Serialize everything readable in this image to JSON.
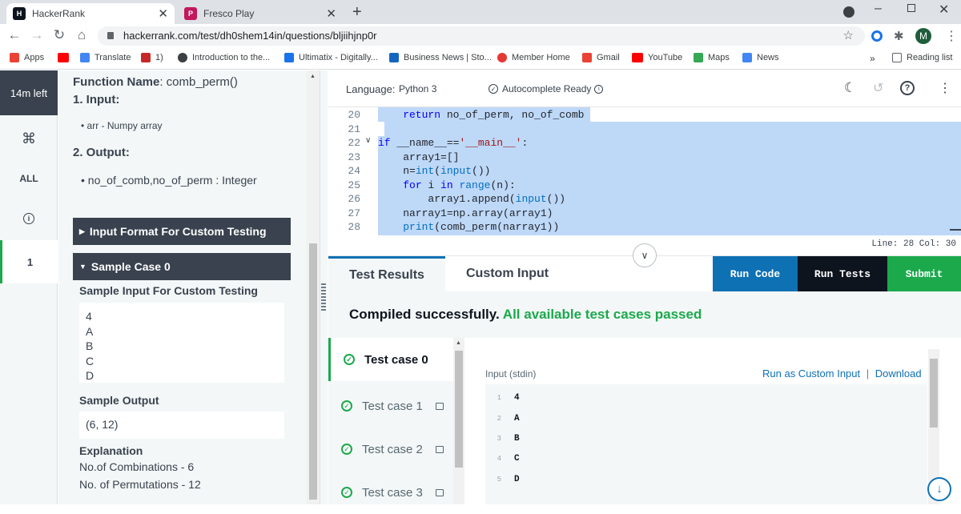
{
  "browser": {
    "tabs": [
      {
        "title": "HackerRank",
        "icon": "hackerrank-logo",
        "active": true
      },
      {
        "title": "Fresco Play",
        "icon": "fresco-logo",
        "active": false
      }
    ],
    "new_tab": "+",
    "url": "hackerrank.com/test/dh0shem14in/questions/bljiihjnp0r",
    "profile_initial": "M",
    "bookmarks": [
      {
        "label": "Apps",
        "color": "#ea4335"
      },
      {
        "label": "",
        "color": "#ff0000"
      },
      {
        "label": "Translate",
        "color": "#4285f4"
      },
      {
        "label": "1)",
        "color": "#c62828"
      },
      {
        "label": "Introduction to the...",
        "color": "#3c4043"
      },
      {
        "label": "Ultimatix - Digitally...",
        "color": "#1a73e8"
      },
      {
        "label": "Business News | Sto...",
        "color": "#1565c0"
      },
      {
        "label": "Member Home",
        "color": "#e53935"
      },
      {
        "label": "Gmail",
        "color": "#ea4335"
      },
      {
        "label": "YouTube",
        "color": "#ff0000"
      },
      {
        "label": "Maps",
        "color": "#34a853"
      },
      {
        "label": "News",
        "color": "#4285f4"
      }
    ],
    "more_bookmarks": "»",
    "reading_list": "Reading list"
  },
  "rail": {
    "timer": "14m left",
    "command_symbol": "⌘",
    "all": "ALL",
    "info_icon": "info-icon",
    "question_number": "1"
  },
  "problem": {
    "function_label": "Function Name",
    "function_name": ": comb_perm()",
    "input_heading": "1. Input:",
    "input_item": "arr - Numpy array",
    "output_heading": "2. Output:",
    "output_item": "no_of_comb,no_of_perm : Integer",
    "input_format_toggle": "Input Format For Custom Testing",
    "sample_case_toggle": "Sample Case 0",
    "sample_input_heading": "Sample Input For Custom Testing",
    "sample_input_lines": [
      "4",
      "A",
      "B",
      "C",
      "D"
    ],
    "sample_output_heading": "Sample Output",
    "sample_output": "(6, 12)",
    "explanation_heading": "Explanation",
    "explanation_lines": [
      "No.of Combinations - 6",
      "No. of Permutations - 12"
    ]
  },
  "editor": {
    "language_label": "Language:",
    "language": "Python 3",
    "autocomplete": "Autocomplete Ready",
    "lines": [
      {
        "n": "20",
        "code": "    return no_of_perm, no_of_comb"
      },
      {
        "n": "21",
        "code": ""
      },
      {
        "n": "22",
        "code": "if __name__=='__main__':"
      },
      {
        "n": "23",
        "code": "    array1=[]"
      },
      {
        "n": "24",
        "code": "    n=int(input())"
      },
      {
        "n": "25",
        "code": "    for i in range(n):"
      },
      {
        "n": "26",
        "code": "        array1.append(input())"
      },
      {
        "n": "27",
        "code": "    narray1=np.array(array1)"
      },
      {
        "n": "28",
        "code": "    print(comb_perm(narray1))"
      }
    ],
    "status": "Line: 28 Col: 30"
  },
  "results": {
    "tab_results": "Test Results",
    "tab_custom": "Custom Input",
    "run_code": "Run Code",
    "run_tests": "Run Tests",
    "submit": "Submit",
    "compiled": "Compiled successfully.",
    "passed": "All available test cases passed",
    "cases": [
      {
        "label": "Test case 0",
        "locked": false
      },
      {
        "label": "Test case 1",
        "locked": true
      },
      {
        "label": "Test case 2",
        "locked": true
      },
      {
        "label": "Test case 3",
        "locked": true
      }
    ],
    "stdin_label": "Input (stdin)",
    "run_custom": "Run as Custom Input",
    "separator": "|",
    "download": "Download",
    "stdin_lines": [
      {
        "n": "1",
        "v": "4"
      },
      {
        "n": "2",
        "v": "A"
      },
      {
        "n": "3",
        "v": "B"
      },
      {
        "n": "4",
        "v": "C"
      },
      {
        "n": "5",
        "v": "D"
      }
    ]
  },
  "colors": {
    "run_code": "#0e71b4",
    "run_tests": "#0e141e",
    "submit": "#1ba94c",
    "dark_panel": "#39424e",
    "pass_green": "#1ba94c"
  }
}
